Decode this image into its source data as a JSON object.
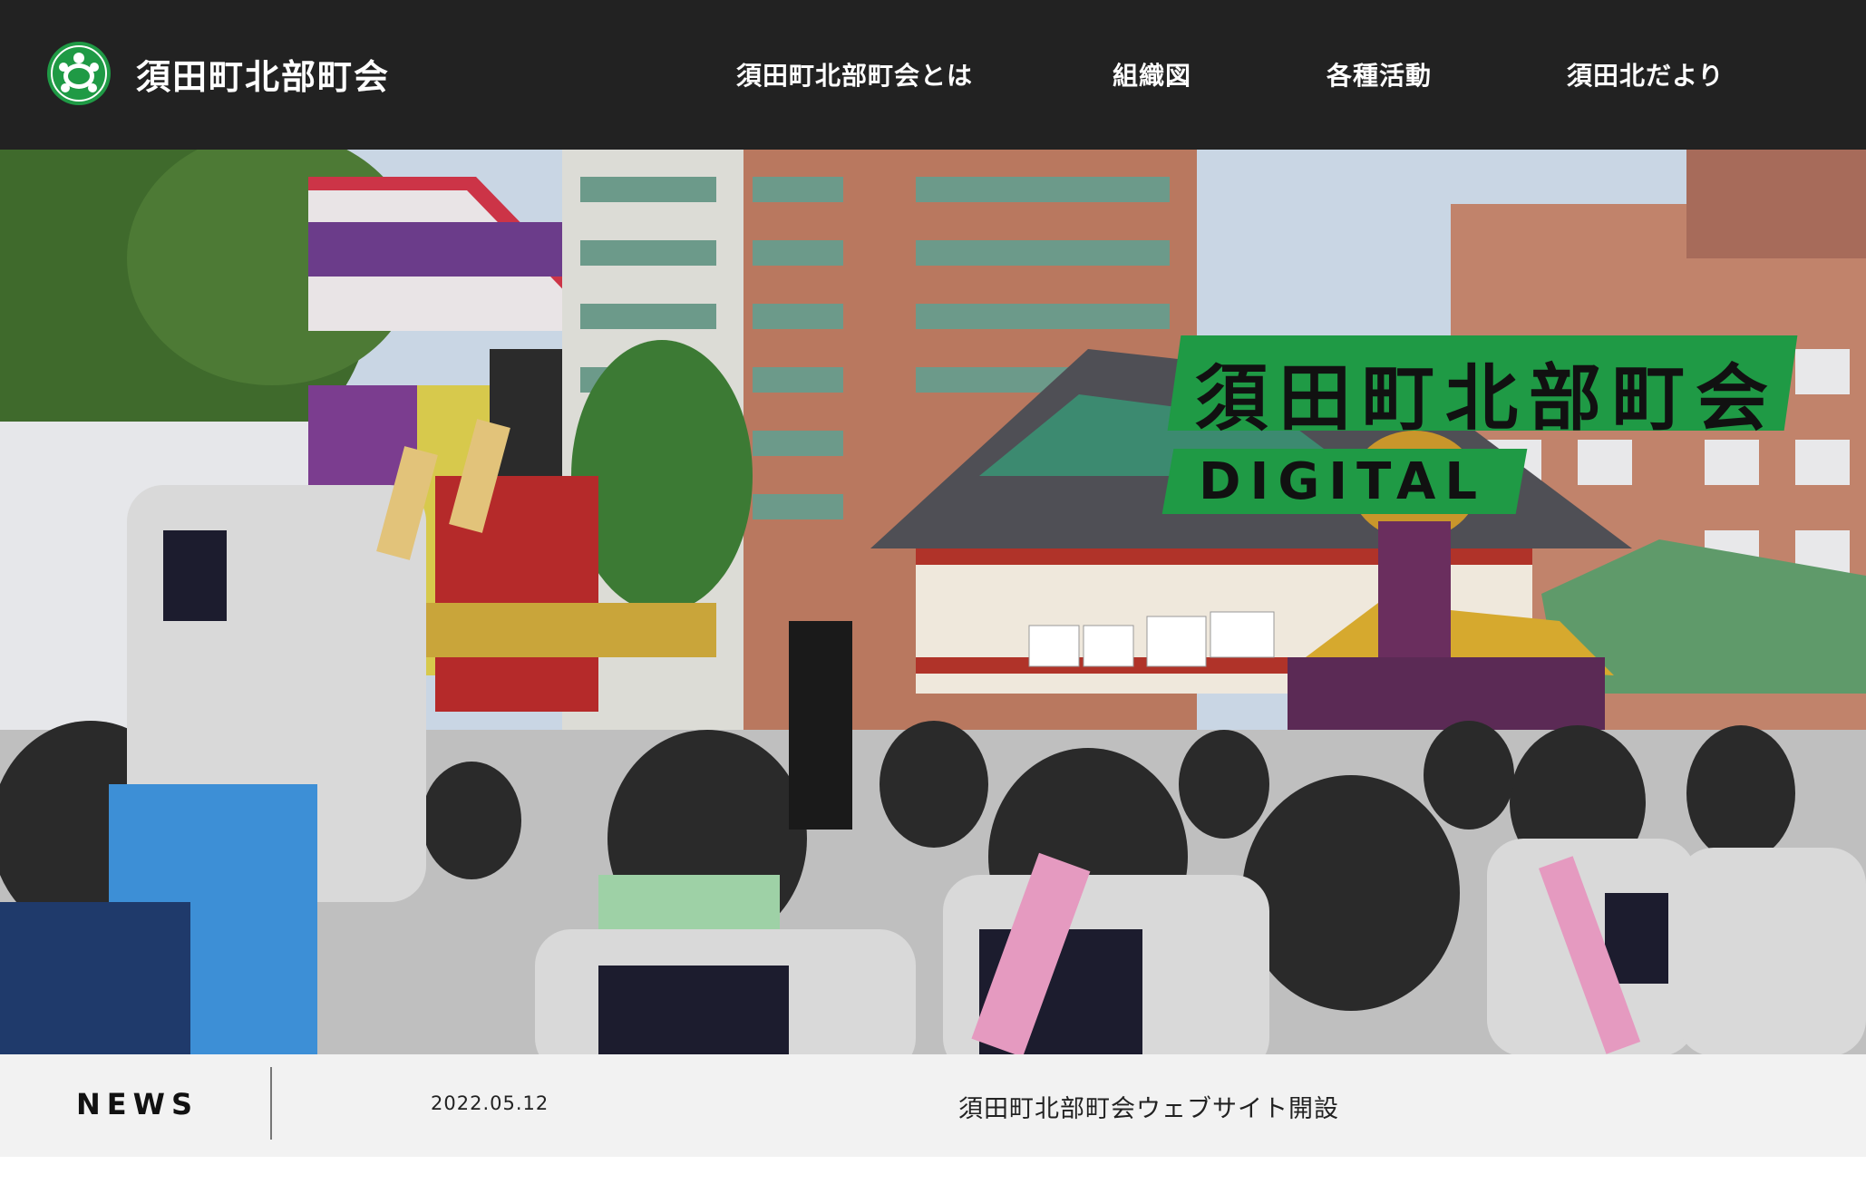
{
  "header": {
    "site_title": "須田町北部町会",
    "logo_icon": "turtle-emblem-icon",
    "nav": [
      {
        "label": "須田町北部町会とは"
      },
      {
        "label": "組織図"
      },
      {
        "label": "各種活動"
      },
      {
        "label": "須田北だより"
      }
    ]
  },
  "hero": {
    "title": "須田町北部町会",
    "subtitle": "DIGITAL",
    "photo_description": "festival-mikoshi-photo"
  },
  "news": {
    "label": "NEWS",
    "items": [
      {
        "date": "2022.05.12",
        "title": "須田町北部町会ウェブサイト開設"
      }
    ]
  },
  "colors": {
    "header_bg": "#222222",
    "accent_green": "#1f9a45",
    "news_bg": "#f2f2f2"
  }
}
